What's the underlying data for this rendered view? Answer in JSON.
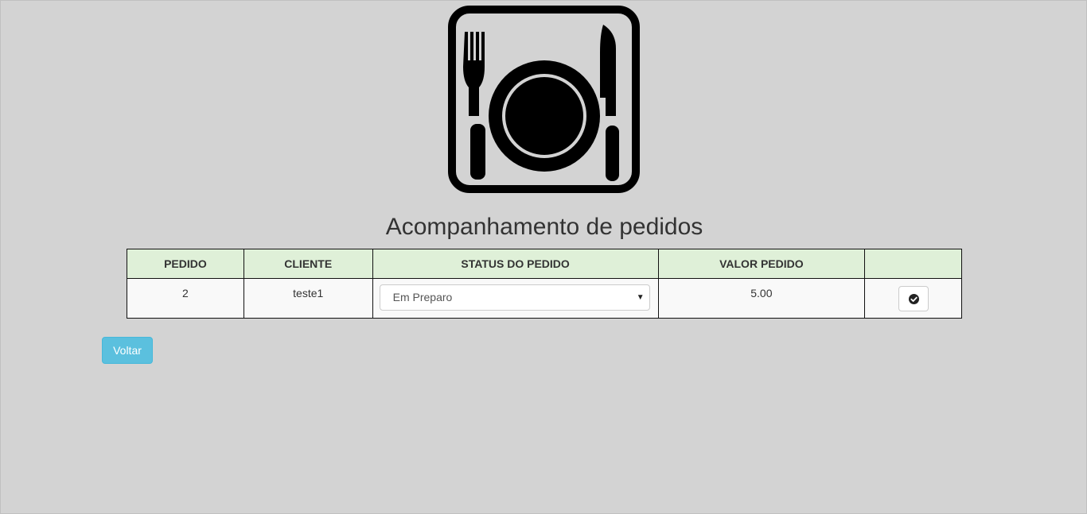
{
  "header": {
    "logo_icon": "plate-fork-knife-icon",
    "title": "Acompanhamento de pedidos"
  },
  "table": {
    "columns": [
      "PEDIDO",
      "CLIENTE",
      "STATUS DO PEDIDO",
      "VALOR PEDIDO",
      ""
    ],
    "rows": [
      {
        "pedido": "2",
        "cliente": "teste1",
        "status": "Em Preparo",
        "valor": "5.00",
        "action_icon": "check-circle-icon"
      }
    ]
  },
  "footer": {
    "back_label": "Voltar"
  },
  "colors": {
    "background": "#d3d3d3",
    "header_row": "#dff0d8",
    "back_button": "#5bc0de"
  }
}
